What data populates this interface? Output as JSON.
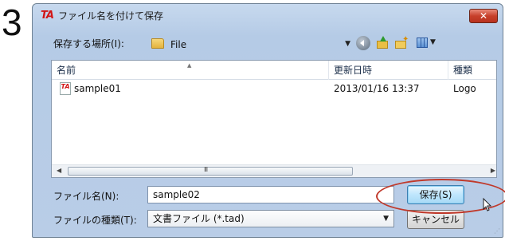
{
  "step": {
    "number": "3"
  },
  "window": {
    "app_icon": "TA",
    "title": "ファイル名を付けて保存",
    "close_label": "✕"
  },
  "location": {
    "label": "保存する場所(I):",
    "value": "File"
  },
  "toolbar": {
    "icons": [
      "back-icon",
      "up-folder-icon",
      "new-folder-icon",
      "views-menu-icon"
    ]
  },
  "file_list": {
    "columns": [
      "名前",
      "更新日時",
      "種類"
    ],
    "rows": [
      {
        "name": "sample01",
        "modified": "2013/01/16 13:37",
        "type": "Logo",
        "icon": "TA"
      }
    ],
    "scroll_grip": "III"
  },
  "filename": {
    "label": "ファイル名(N):",
    "value": "sample02"
  },
  "filetype": {
    "label": "ファイルの種類(T):",
    "value": "文書ファイル (*.tad)"
  },
  "buttons": {
    "save": "保存(S)",
    "cancel": "キャンセル"
  },
  "colors": {
    "highlight": "#c0392b",
    "app_icon": "#d21414",
    "save_accent": "#3c7fb1"
  }
}
